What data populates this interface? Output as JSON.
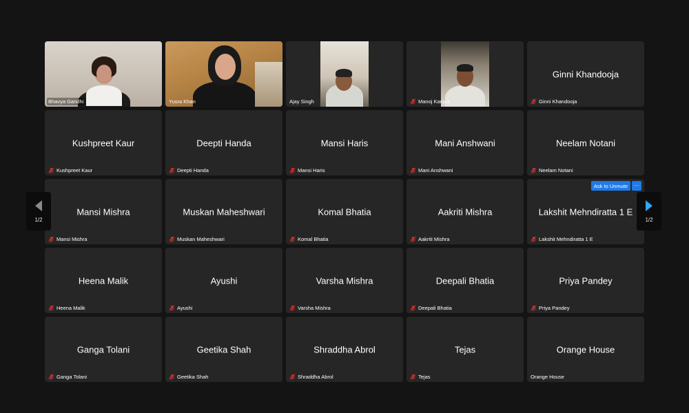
{
  "participants": [
    {
      "name": "Bhavya Gandhi",
      "video": true,
      "muted": true
    },
    {
      "name": "Yusra Khan",
      "video": true,
      "muted": false
    },
    {
      "name": "Ajay Singh",
      "video": true,
      "muted": false
    },
    {
      "name": "Manoj Kanpur",
      "video": true,
      "muted": true
    },
    {
      "name": "Ginni Khandooja",
      "video": false,
      "muted": true
    },
    {
      "name": "Kushpreet Kaur",
      "video": false,
      "muted": true
    },
    {
      "name": "Deepti Handa",
      "video": false,
      "muted": true
    },
    {
      "name": "Mansi Haris",
      "video": false,
      "muted": true
    },
    {
      "name": "Mani Anshwani",
      "video": false,
      "muted": true
    },
    {
      "name": "Neelam Notani",
      "video": false,
      "muted": true
    },
    {
      "name": "Mansi Mishra",
      "video": false,
      "muted": true
    },
    {
      "name": "Muskan Maheshwari",
      "video": false,
      "muted": true
    },
    {
      "name": "Komal Bhatia",
      "video": false,
      "muted": true
    },
    {
      "name": "Aakriti Mishra",
      "video": false,
      "muted": true
    },
    {
      "name": "Lakshit Mehndiratta 1 E",
      "video": false,
      "muted": true
    },
    {
      "name": "Heena Malik",
      "video": false,
      "muted": true
    },
    {
      "name": "Ayushi",
      "video": false,
      "muted": true
    },
    {
      "name": "Varsha Mishra",
      "video": false,
      "muted": true
    },
    {
      "name": "Deepali Bhatia",
      "video": false,
      "muted": true
    },
    {
      "name": "Priya Pandey",
      "video": false,
      "muted": true
    },
    {
      "name": "Ganga Tolani",
      "video": false,
      "muted": true
    },
    {
      "name": "Geetika Shah",
      "video": false,
      "muted": true
    },
    {
      "name": "Shraddha Abrol",
      "video": false,
      "muted": true
    },
    {
      "name": "Tejas",
      "video": false,
      "muted": true
    },
    {
      "name": "Orange House",
      "video": false,
      "muted": false
    }
  ],
  "pagination": {
    "prev_label": "1/2",
    "next_label": "1/2"
  },
  "hover_controls": {
    "ask_to_unmute": "Ask to Unmute",
    "more": "···"
  },
  "colors": {
    "background": "#141414",
    "tile": "#262626",
    "active_speaker_border": "#37c256",
    "muted_icon": "#e0302e",
    "accent": "#1f7ae8",
    "next_arrow": "#2fa8f5"
  },
  "icons": [
    "muted-mic-icon",
    "prev-page-arrow-icon",
    "next-page-arrow-icon",
    "more-options-icon"
  ]
}
